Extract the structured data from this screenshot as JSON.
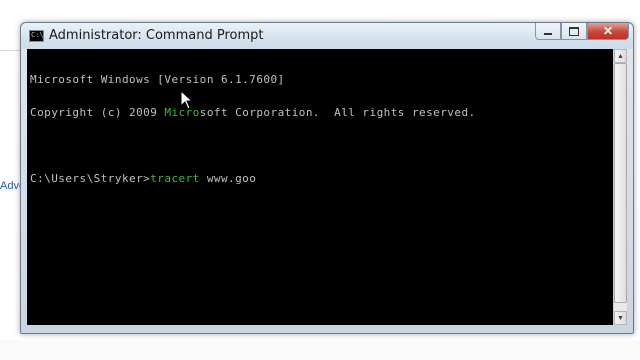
{
  "background": {
    "page_fragment_text": "Adve"
  },
  "window": {
    "title": "Administrator: Command Prompt",
    "icon": "cmd-console-icon",
    "controls": {
      "minimize_icon": "minimize-icon",
      "maximize_icon": "maximize-icon",
      "close_label": "✕"
    }
  },
  "console": {
    "line1": "Microsoft Windows [Version 6.1.7600]",
    "line2_a": "Copyright (c) 2009 ",
    "line2_b": "Micro",
    "line2_c": "soft Corporation.  All rights reserved.",
    "prompt": "C:\\Users\\Stryker>",
    "command_a": "tracert",
    "command_b": " www.goo"
  },
  "colors": {
    "console_bg": "#000000",
    "console_text": "#c0c0c0",
    "highlight_green": "#3db83d",
    "close_button": "#c8463a"
  }
}
